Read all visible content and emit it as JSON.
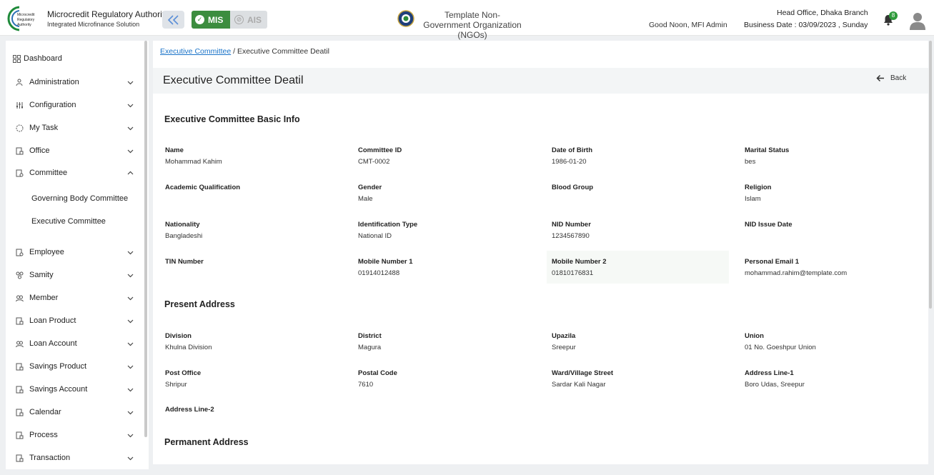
{
  "header": {
    "logo_text": "Microcredit Regulatory Authority",
    "org_title": "Microcredit Regulatory Authority",
    "org_subtitle": "Integrated Microfinance Solution",
    "mode_mis": "MIS",
    "mode_ais": "AIS",
    "ngo_name": "Template Non-Government Organization (NGOs)",
    "greeting": "Good Noon, MFI Admin",
    "branch": "Head Office, Dhaka Branch",
    "business_date": "Business Date : 03/09/2023 , Sunday",
    "notification_count": "8",
    "accent_green": "#3c8d3f"
  },
  "sidebar": {
    "dashboard": "Dashboard",
    "items": [
      {
        "label": "Administration",
        "icon": "users-gear-icon"
      },
      {
        "label": "Configuration",
        "icon": "sliders-icon"
      },
      {
        "label": "My Task",
        "icon": "task-circle-icon"
      },
      {
        "label": "Office",
        "icon": "office-icon"
      },
      {
        "label": "Committee",
        "icon": "committee-icon"
      },
      {
        "label": "Employee",
        "icon": "employee-icon"
      },
      {
        "label": "Samity",
        "icon": "samity-icon"
      },
      {
        "label": "Member",
        "icon": "member-icon"
      },
      {
        "label": "Loan Product",
        "icon": "loan-product-icon"
      },
      {
        "label": "Loan Account",
        "icon": "loan-account-icon"
      },
      {
        "label": "Savings Product",
        "icon": "savings-product-icon"
      },
      {
        "label": "Savings Account",
        "icon": "savings-account-icon"
      },
      {
        "label": "Calendar",
        "icon": "calendar-icon"
      },
      {
        "label": "Process",
        "icon": "process-icon"
      },
      {
        "label": "Transaction",
        "icon": "transaction-icon"
      }
    ],
    "committee_sub": [
      "Governing Body Committee",
      "Executive Committee"
    ]
  },
  "breadcrumb": {
    "link": "Executive Committee",
    "separator": "/",
    "current": "Executive Committee Deatil"
  },
  "page": {
    "title": "Executive Committee Deatil",
    "back_label": "Back"
  },
  "basic_info": {
    "title": "Executive Committee Basic Info",
    "fields": [
      {
        "label": "Name",
        "value": "Mohammad Kahim"
      },
      {
        "label": "Committee ID",
        "value": "CMT-0002"
      },
      {
        "label": "Date of Birth",
        "value": "1986-01-20"
      },
      {
        "label": "Marital Status",
        "value": "bes"
      },
      {
        "label": "Academic Qualification",
        "value": ""
      },
      {
        "label": "Gender",
        "value": "Male"
      },
      {
        "label": "Blood Group",
        "value": ""
      },
      {
        "label": "Religion",
        "value": "Islam"
      },
      {
        "label": "Nationality",
        "value": "Bangladeshi"
      },
      {
        "label": "Identification Type",
        "value": "National ID"
      },
      {
        "label": "NID Number",
        "value": "1234567890"
      },
      {
        "label": "NID Issue Date",
        "value": ""
      },
      {
        "label": "TIN Number",
        "value": ""
      },
      {
        "label": "Mobile Number 1",
        "value": "01914012488"
      },
      {
        "label": "Mobile Number 2",
        "value": "01810176831"
      },
      {
        "label": "Personal Email 1",
        "value": "mohammad.rahim@template.com"
      }
    ]
  },
  "present_address": {
    "title": "Present Address",
    "fields": [
      {
        "label": "Division",
        "value": "Khulna Division"
      },
      {
        "label": "District",
        "value": "Magura"
      },
      {
        "label": "Upazila",
        "value": "Sreepur"
      },
      {
        "label": "Union",
        "value": "01 No. Goeshpur Union"
      },
      {
        "label": "Post Office",
        "value": "Shripur"
      },
      {
        "label": "Postal Code",
        "value": "7610"
      },
      {
        "label": "Ward/Village Street",
        "value": "Sardar Kali Nagar"
      },
      {
        "label": "Address Line-1",
        "value": "Boro Udas, Sreepur"
      },
      {
        "label": "Address Line-2",
        "value": ""
      }
    ]
  },
  "permanent_address": {
    "title": "Permanent Address"
  }
}
